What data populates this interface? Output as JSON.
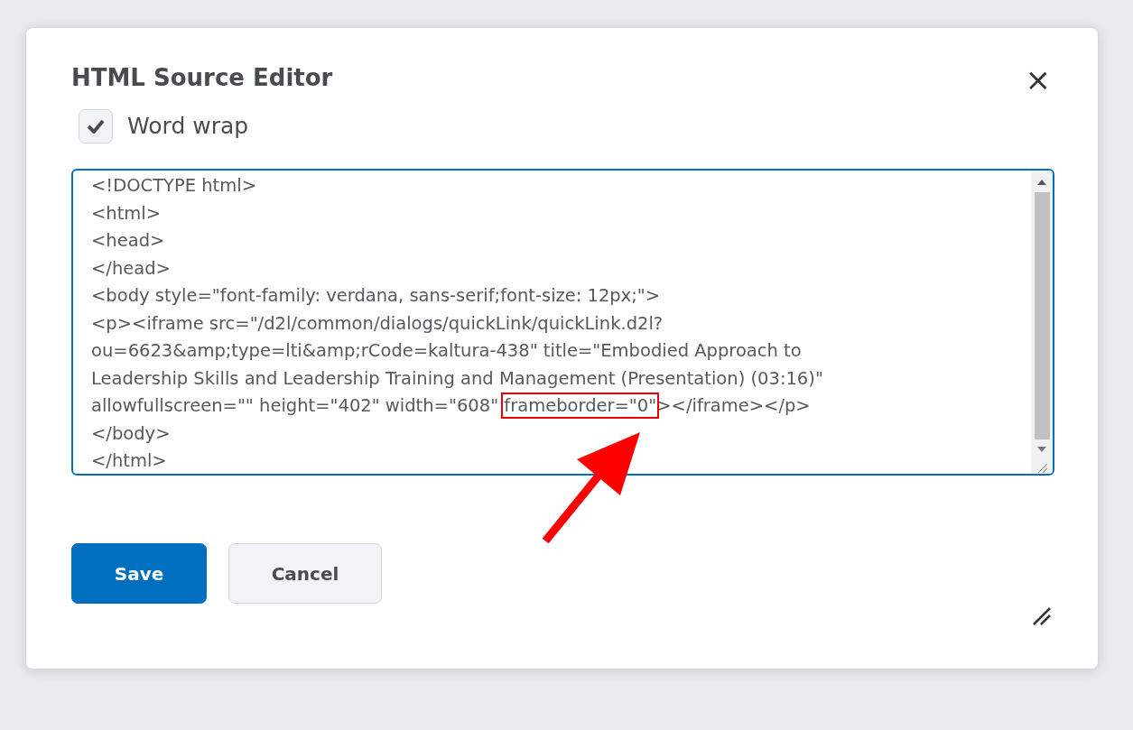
{
  "dialog": {
    "title": "HTML Source Editor",
    "close": "×"
  },
  "word_wrap": {
    "label": "Word wrap",
    "checked": true
  },
  "source_lines": [
    {
      "kind": "plain",
      "text": "<!DOCTYPE html>"
    },
    {
      "kind": "plain",
      "text": "<html>"
    },
    {
      "kind": "plain",
      "text": "<head>"
    },
    {
      "kind": "plain",
      "text": "</head>"
    },
    {
      "kind": "plain",
      "text": "<body style=\"font-family: verdana, sans-serif;font-size: 12px;\">"
    },
    {
      "kind": "plain",
      "text": "<p><iframe src=\"/d2l/common/dialogs/quickLink/quickLink.d2l?"
    },
    {
      "kind": "plain",
      "text": "ou=6623&amp;type=lti&amp;rCode=kaltura-438\" title=\"Embodied Approach to"
    },
    {
      "kind": "plain",
      "text": "Leadership Skills and Leadership Training and Management (Presentation) (03:16)\""
    },
    {
      "kind": "highlighted",
      "before": "allowfullscreen=\"\" height=\"402\" width=\"608\" ",
      "highlight": "frameborder=\"0\"",
      "after": "></iframe></p>"
    },
    {
      "kind": "plain",
      "text": "</body>"
    },
    {
      "kind": "plain",
      "text": "</html>"
    }
  ],
  "buttons": [
    {
      "label": "Save",
      "kind": "primary"
    },
    {
      "label": "Cancel",
      "kind": "secondary"
    }
  ]
}
